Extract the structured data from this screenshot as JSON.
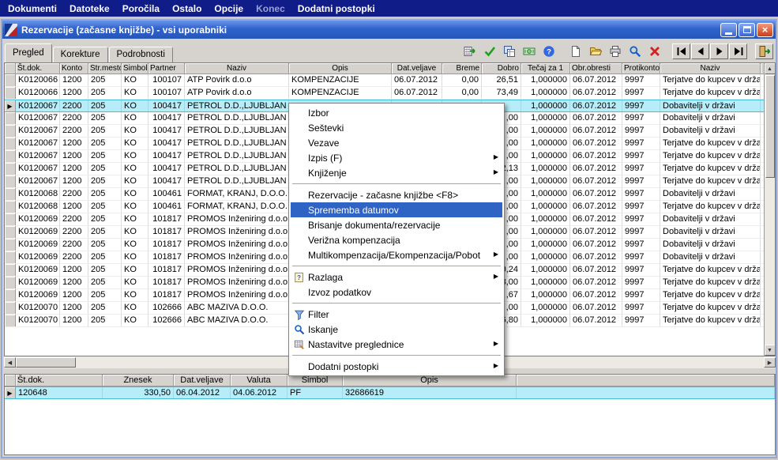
{
  "menubar": {
    "items": [
      {
        "label": "Dokumenti"
      },
      {
        "label": "Datoteke"
      },
      {
        "label": "Poročila"
      },
      {
        "label": "Ostalo"
      },
      {
        "label": "Opcije"
      },
      {
        "label": "Konec",
        "dim": true
      },
      {
        "label": "Dodatni postopki"
      }
    ]
  },
  "window": {
    "title": "Rezervacije (začasne knjižbe) - vsi uporabniki",
    "controls": [
      "minimize-icon",
      "maximize-icon",
      "close-icon"
    ]
  },
  "tabs": [
    {
      "label": "Pregled",
      "active": true
    },
    {
      "label": "Korekture",
      "active": false
    },
    {
      "label": "Podrobnosti",
      "active": false
    }
  ],
  "toolbar": {
    "buttons": [
      {
        "name": "grid-export-icon"
      },
      {
        "name": "confirm-icon"
      },
      {
        "name": "copy-grid-icon"
      },
      {
        "name": "money-icon"
      },
      {
        "name": "help-icon"
      },
      {
        "name": "new-document-icon",
        "gap": true
      },
      {
        "name": "open-folder-icon"
      },
      {
        "name": "print-icon"
      },
      {
        "name": "search-icon"
      },
      {
        "name": "delete-icon"
      },
      {
        "name": "first-record-icon",
        "gap": true,
        "raised": true
      },
      {
        "name": "previous-record-icon",
        "raised": true
      },
      {
        "name": "next-record-icon",
        "raised": true
      },
      {
        "name": "last-record-icon",
        "raised": true
      },
      {
        "name": "exit-icon",
        "gap": true,
        "raised": true
      }
    ]
  },
  "icons": {
    "row_marker": "▶",
    "submenu_arrow": "▶",
    "scroll_up": "▲",
    "scroll_down": "▼",
    "scroll_left": "◀",
    "scroll_right": "▶"
  },
  "colors": {
    "selection": "#b7edf8",
    "menu_highlight": "#2f63c4",
    "titlebar_blue": "#2e62cd",
    "menubar_navy": "#101c87",
    "chrome_gray": "#d6d3ce"
  },
  "main_grid": {
    "columns": [
      "Št.dok.",
      "Konto",
      "Str.mesto",
      "Simbol",
      "Partner",
      "Naziv",
      "Opis",
      "Dat.veljave",
      "Breme",
      "Dobro",
      "Tečaj za 1",
      "Obr.obresti",
      "Protikonto",
      "Naziv"
    ],
    "rows": [
      {
        "cells": [
          "K0120066",
          "1200",
          "205",
          "KO",
          "100107",
          "ATP Povirk d.o.o",
          "KOMPENZACIJE",
          "06.07.2012",
          "0,00",
          "26,51",
          "1,000000",
          "06.07.2012",
          "9997",
          "Terjatve do kupcev v državi"
        ]
      },
      {
        "cells": [
          "K0120066",
          "1200",
          "205",
          "KO",
          "100107",
          "ATP Povirk d.o.o",
          "KOMPENZACIJE",
          "06.07.2012",
          "0,00",
          "73,49",
          "1,000000",
          "06.07.2012",
          "9997",
          "Terjatve do kupcev v državi"
        ]
      },
      {
        "cells": [
          "K0120067",
          "2200",
          "205",
          "KO",
          "100417",
          "PETROL D.D.,LJUBLJAN",
          "",
          "",
          "",
          "",
          "1,000000",
          "06.07.2012",
          "9997",
          "Dobavitelji v državi"
        ],
        "selected": true
      },
      {
        "cells": [
          "K0120067",
          "2200",
          "205",
          "KO",
          "100417",
          "PETROL D.D.,LJUBLJAN",
          "",
          "",
          "",
          ",00",
          "1,000000",
          "06.07.2012",
          "9997",
          "Dobavitelji v državi"
        ]
      },
      {
        "cells": [
          "K0120067",
          "2200",
          "205",
          "KO",
          "100417",
          "PETROL D.D.,LJUBLJAN",
          "",
          "",
          "",
          ",00",
          "1,000000",
          "06.07.2012",
          "9997",
          "Dobavitelji v državi"
        ]
      },
      {
        "cells": [
          "K0120067",
          "1200",
          "205",
          "KO",
          "100417",
          "PETROL D.D.,LJUBLJAN",
          "",
          "",
          "",
          ",00",
          "1,000000",
          "06.07.2012",
          "9997",
          "Terjatve do kupcev v državi"
        ]
      },
      {
        "cells": [
          "K0120067",
          "1200",
          "205",
          "KO",
          "100417",
          "PETROL D.D.,LJUBLJAN",
          "",
          "",
          "",
          ",00",
          "1,000000",
          "06.07.2012",
          "9997",
          "Terjatve do kupcev v državi"
        ]
      },
      {
        "cells": [
          "K0120067",
          "1200",
          "205",
          "KO",
          "100417",
          "PETROL D.D.,LJUBLJAN",
          "",
          "",
          "",
          "2,13",
          "1,000000",
          "06.07.2012",
          "9997",
          "Terjatve do kupcev v državi"
        ]
      },
      {
        "cells": [
          "K0120067",
          "1200",
          "205",
          "KO",
          "100417",
          "PETROL D.D.,LJUBLJAN",
          "",
          "",
          "",
          ",00",
          "1,000000",
          "06.07.2012",
          "9997",
          "Terjatve do kupcev v državi"
        ]
      },
      {
        "cells": [
          "K0120068",
          "2200",
          "205",
          "KO",
          "100461",
          "FORMAT, KRANJ, D.O.O.",
          "",
          "",
          "",
          ",00",
          "1,000000",
          "06.07.2012",
          "9997",
          "Dobavitelji v državi"
        ]
      },
      {
        "cells": [
          "K0120068",
          "1200",
          "205",
          "KO",
          "100461",
          "FORMAT, KRANJ, D.O.O.",
          "",
          "",
          "",
          ",00",
          "1,000000",
          "06.07.2012",
          "9997",
          "Terjatve do kupcev v državi"
        ]
      },
      {
        "cells": [
          "K0120069",
          "2200",
          "205",
          "KO",
          "101817",
          "PROMOS Inženiring d.o.o",
          "",
          "",
          "",
          ",00",
          "1,000000",
          "06.07.2012",
          "9997",
          "Dobavitelji v državi"
        ]
      },
      {
        "cells": [
          "K0120069",
          "2200",
          "205",
          "KO",
          "101817",
          "PROMOS Inženiring d.o.o",
          "",
          "",
          "",
          ",00",
          "1,000000",
          "06.07.2012",
          "9997",
          "Dobavitelji v državi"
        ]
      },
      {
        "cells": [
          "K0120069",
          "2200",
          "205",
          "KO",
          "101817",
          "PROMOS Inženiring d.o.o",
          "",
          "",
          "",
          ",00",
          "1,000000",
          "06.07.2012",
          "9997",
          "Dobavitelji v državi"
        ]
      },
      {
        "cells": [
          "K0120069",
          "2200",
          "205",
          "KO",
          "101817",
          "PROMOS Inženiring d.o.o",
          "",
          "",
          "",
          ",00",
          "1,000000",
          "06.07.2012",
          "9997",
          "Dobavitelji v državi"
        ]
      },
      {
        "cells": [
          "K0120069",
          "1200",
          "205",
          "KO",
          "101817",
          "PROMOS Inženiring d.o.o",
          "",
          "",
          "",
          "0,24",
          "1,000000",
          "06.07.2012",
          "9997",
          "Terjatve do kupcev v državi"
        ]
      },
      {
        "cells": [
          "K0120069",
          "1200",
          "205",
          "KO",
          "101817",
          "PROMOS Inženiring d.o.o",
          "",
          "",
          "",
          "3,00",
          "1,000000",
          "06.07.2012",
          "9997",
          "Terjatve do kupcev v državi"
        ]
      },
      {
        "cells": [
          "K0120069",
          "1200",
          "205",
          "KO",
          "101817",
          "PROMOS Inženiring d.o.o",
          "",
          "",
          "",
          ",67",
          "1,000000",
          "06.07.2012",
          "9997",
          "Terjatve do kupcev v državi"
        ]
      },
      {
        "cells": [
          "K0120070",
          "1200",
          "205",
          "KO",
          "102666",
          "ABC MAZIVA D.O.O.",
          "",
          "",
          "",
          ",00",
          "1,000000",
          "06.07.2012",
          "9997",
          "Terjatve do kupcev v državi"
        ]
      },
      {
        "cells": [
          "K0120070",
          "1200",
          "205",
          "KO",
          "102666",
          "ABC MAZIVA D.O.O.",
          "",
          "",
          "",
          "6,80",
          "1,000000",
          "06.07.2012",
          "9997",
          "Terjatve do kupcev v državi"
        ]
      }
    ]
  },
  "context_menu": {
    "items": [
      {
        "label": "Izbor"
      },
      {
        "label": "Seštevki"
      },
      {
        "label": "Vezave"
      },
      {
        "label": "Izpis (F)",
        "submenu": true
      },
      {
        "label": "Knjiženje",
        "submenu": true
      },
      {
        "separator": true
      },
      {
        "label": "Rezervacije - začasne knjižbe <F8>"
      },
      {
        "label": "Sprememba datumov",
        "highlighted": true
      },
      {
        "label": "Brisanje dokumenta/rezervacije"
      },
      {
        "label": "Verižna kompenzacija"
      },
      {
        "label": "Multikompenzacija/Ekompenzacija/Pobot",
        "submenu": true
      },
      {
        "separator": true
      },
      {
        "label": "Razlaga",
        "icon": "explain-icon",
        "submenu": true
      },
      {
        "label": "Izvoz podatkov"
      },
      {
        "separator": true
      },
      {
        "label": "Filter",
        "icon": "filter-icon"
      },
      {
        "label": "Iskanje",
        "icon": "search-icon"
      },
      {
        "label": "Nastavitve preglednice",
        "icon": "grid-settings-icon",
        "submenu": true
      },
      {
        "separator": true
      },
      {
        "label": "Dodatni postopki",
        "submenu": true
      }
    ]
  },
  "bottom_grid": {
    "columns": [
      "Št.dok.",
      "Znesek",
      "Dat.veljave",
      "Valuta",
      "Simbol",
      "Opis"
    ],
    "rows": [
      {
        "cells": [
          "120648",
          "330,50",
          "06.04.2012",
          "04.06.2012",
          "PF",
          "32686619"
        ],
        "selected": true
      }
    ]
  }
}
